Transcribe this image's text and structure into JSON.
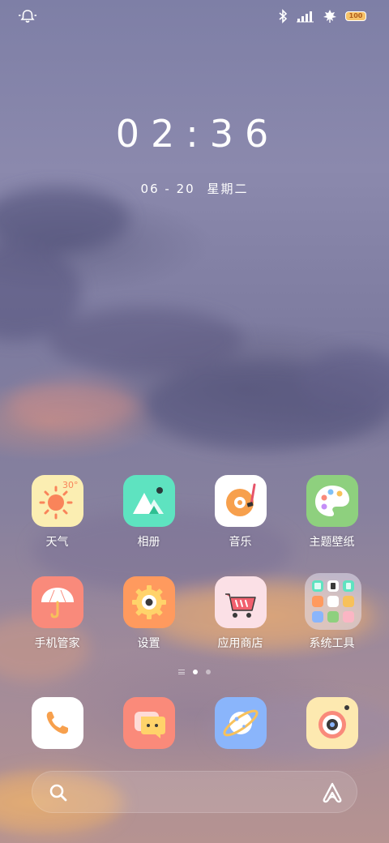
{
  "status_bar": {
    "left_icon": "bell-snooze-icon",
    "right_icons": [
      "bluetooth-icon",
      "signal-icon",
      "leaf-icon"
    ],
    "battery": "100"
  },
  "lock": {
    "time": "02:36",
    "date_digits": "06 - 20",
    "weekday": "星期二"
  },
  "apps": [
    {
      "label": "天气",
      "icon": "weather-sun-icon",
      "temp": "30°"
    },
    {
      "label": "相册",
      "icon": "gallery-icon"
    },
    {
      "label": "音乐",
      "icon": "music-record-icon"
    },
    {
      "label": "主题壁纸",
      "icon": "palette-icon"
    },
    {
      "label": "手机管家",
      "icon": "umbrella-icon"
    },
    {
      "label": "设置",
      "icon": "gear-icon"
    },
    {
      "label": "应用商店",
      "icon": "shopping-cart-icon"
    },
    {
      "label": "系统工具",
      "icon": "folder-icon"
    }
  ],
  "page_indicator": {
    "pages": 2,
    "active": 1
  },
  "dock": [
    {
      "icon": "phone-icon"
    },
    {
      "icon": "message-icon"
    },
    {
      "icon": "browser-planet-icon"
    },
    {
      "icon": "camera-icon"
    }
  ],
  "search": {
    "left_icon": "search-icon",
    "right_icon": "assistant-icon"
  },
  "colors": {
    "weather_bg": "#fbeeb2",
    "gallery_bg": "#5ee3c0",
    "music_bg": "#ffffff",
    "palette_bg": "#8ed07e",
    "umbrella_bg": "#f98a7b",
    "gear_bg": "#ff9a5e",
    "store_bg": "#fbe0e6",
    "folder_bg": "rgba(230,225,240,0.55)",
    "phone_bg": "#ffffff",
    "message_bg": "#fa8a7a",
    "browser_bg": "#8ab5fb",
    "camera_bg": "#fde9b0"
  }
}
